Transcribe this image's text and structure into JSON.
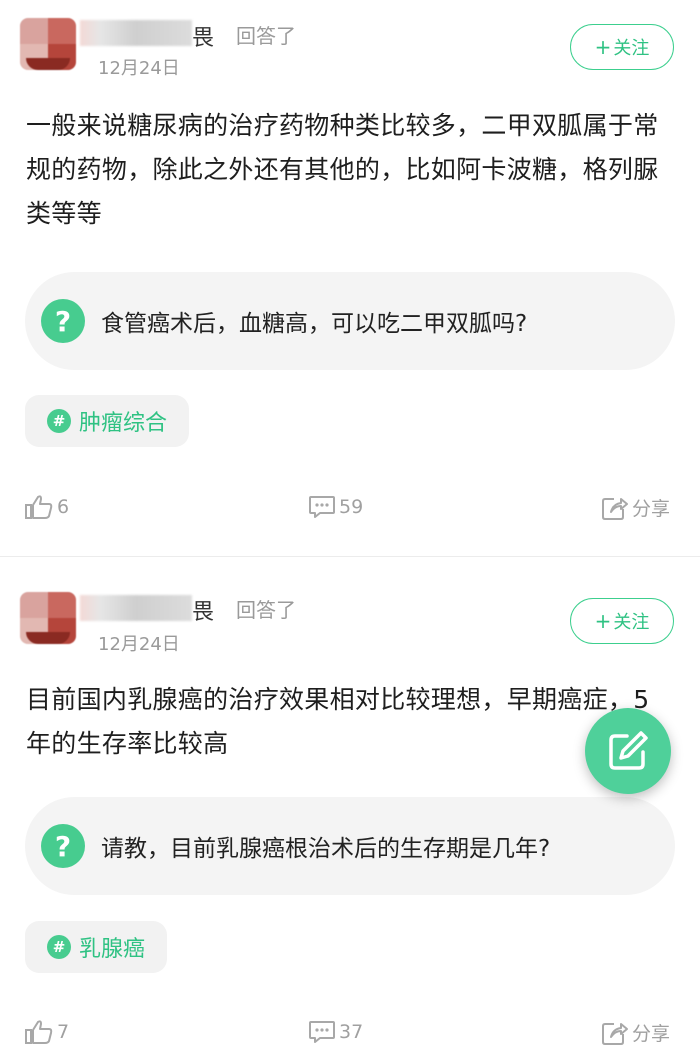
{
  "answers": [
    {
      "author_suffix": "畏",
      "action_text": "回答了",
      "date": "12月24日",
      "follow_label": "关注",
      "body": "一般来说糖尿病的治疗药物种类比较多，二甲双胍属于常规的药物，除此之外还有其他的，比如阿卡波糖，格列脲类等等",
      "question": "食管癌术后，血糖高，可以吃二甲双胍吗?",
      "tag": "肿瘤综合",
      "likes": "6",
      "comments": "59",
      "share_label": "分享"
    },
    {
      "author_suffix": "畏",
      "action_text": "回答了",
      "date": "12月24日",
      "follow_label": "关注",
      "body": "目前国内乳腺癌的治疗效果相对比较理想，早期癌症，5年的生存率比较高",
      "question": "请教，目前乳腺癌根治术后的生存期是几年?",
      "tag": "乳腺癌",
      "likes": "7",
      "comments": "37",
      "share_label": "分享"
    }
  ],
  "colors": {
    "accent": "#3ccf8e",
    "muted": "#9a9a9a",
    "bubble": "#f4f4f4"
  },
  "icons": {
    "question": "question-circle-icon",
    "tag": "hashtag-icon",
    "like": "thumbs-up-icon",
    "comment": "comment-icon",
    "share": "share-icon",
    "fab": "edit-icon"
  }
}
